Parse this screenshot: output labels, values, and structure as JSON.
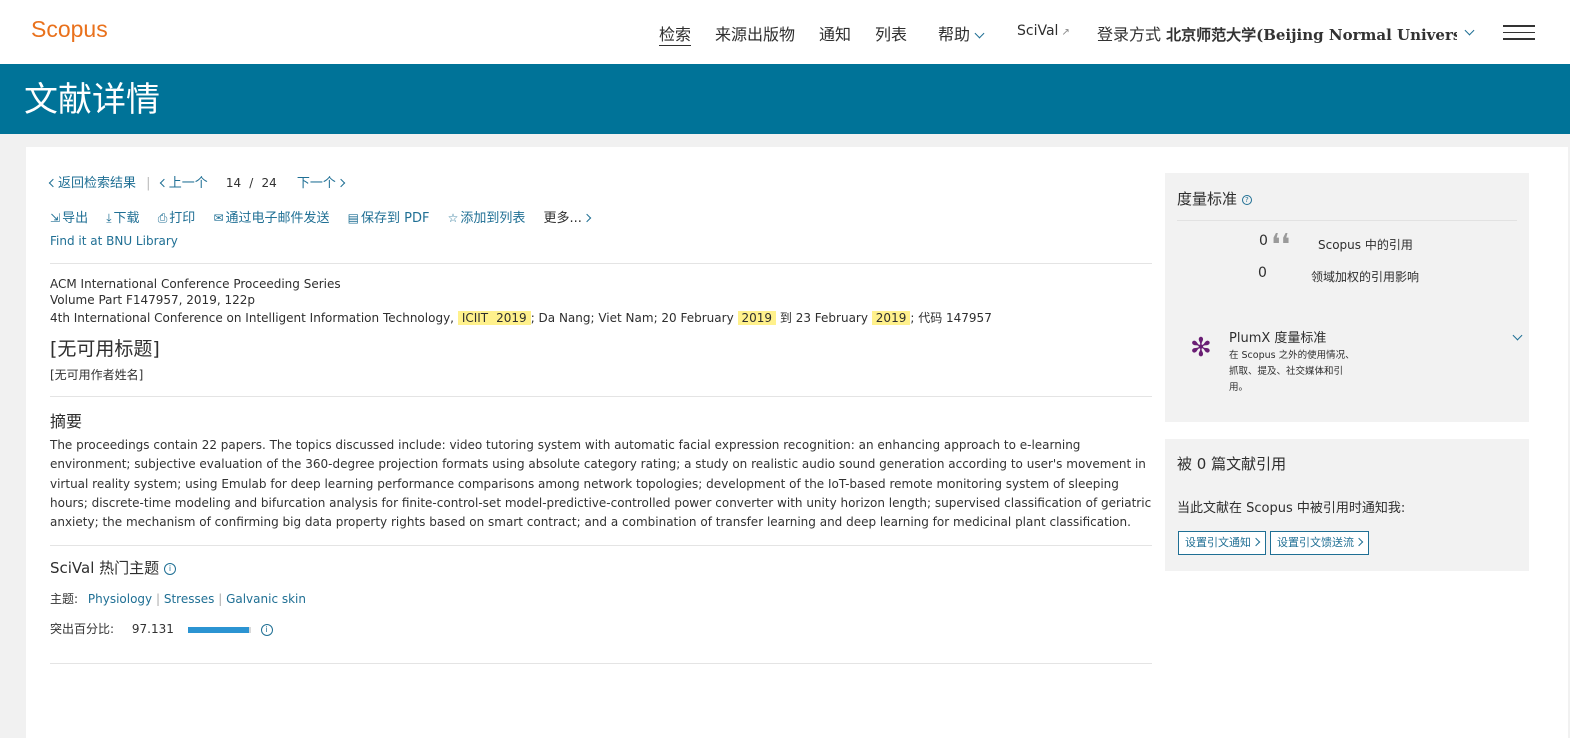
{
  "header": {
    "logo": "Scopus",
    "nav": [
      "检索",
      "来源出版物",
      "通知",
      "列表",
      "帮助",
      "SciVal"
    ],
    "login_prefix": "登录方式",
    "login_institution": "北京师范大学(Beijing Normal Universi"
  },
  "page_title": "文献详情",
  "results_nav": {
    "back": "返回检索结果",
    "prev": "上一个",
    "current": "14",
    "slash": "/",
    "total": "24",
    "next": "下一个"
  },
  "toolbar": {
    "export": "导出",
    "download": "下载",
    "print": "打印",
    "email": "通过电子邮件发送",
    "save_pdf": "保存到 PDF",
    "add_list": "添加到列表",
    "more": "更多..."
  },
  "find_library": "Find it at BNU Library",
  "source": {
    "series": "ACM International Conference Proceeding Series",
    "volume": "Volume Part F147957, 2019, 122p",
    "conf_prefix": "4th International Conference on Intelligent Information Technology,",
    "hl1": "ICIIT",
    "hl2": "2019",
    "conf_mid": "; Da Nang; Viet Nam; 20 February",
    "hl3": "2019",
    "conf_to": "到 23 February",
    "hl4": "2019",
    "conf_code": "; 代码 147957"
  },
  "doc_title": "[无可用标题]",
  "authors": "[无可用作者姓名]",
  "abstract_heading": "摘要",
  "abstract": "The proceedings contain 22 papers. The topics discussed include: video tutoring system with automatic facial expression recognition: an enhancing approach to e-learning environment; subjective evaluation of the 360-degree projection formats using absolute category rating; a study on realistic audio sound generation according to user's movement in virtual reality system; using Emulab for deep learning performance comparisons among network topologies; development of the IoT-based remote monitoring system of sleeping hours; discrete-time modeling and bifurcation analysis for finite-control-set model-predictive-controlled power converter with unity horizon length; supervised classification of geriatric anxiety; the mechanism of confirming big data property rights based on smart contract; and a combination of transfer learning and deep learning for medicinal plant classification.",
  "scival": {
    "heading": "SciVal 热门主题",
    "topic_label": "主题:",
    "topics": [
      "Physiology",
      "Stresses",
      "Galvanic skin"
    ],
    "prominence_label": "突出百分比:",
    "prominence_value": "97.131",
    "prominence_fraction": 0.97131
  },
  "metrics": {
    "heading": "度量标准",
    "citations_value": "0",
    "citations_label": "Scopus 中的引用",
    "fwci_value": "0",
    "fwci_label": "领域加权的引用影响",
    "plumx_title": "PlumX 度量标准",
    "plumx_desc": "在 Scopus 之外的使用情况、抓取、提及、社交媒体和引用。"
  },
  "cited_by": {
    "heading": "被 0 篇文献引用",
    "desc": "当此文献在 Scopus 中被引用时通知我:",
    "btn_alert": "设置引文通知",
    "btn_feed": "设置引文馈送流"
  },
  "colors": {
    "brand_orange": "#e9711c",
    "header_blue": "#007398",
    "link": "#1f6f94",
    "highlight": "#fff18c",
    "plumx_purple": "#6a1e74"
  }
}
